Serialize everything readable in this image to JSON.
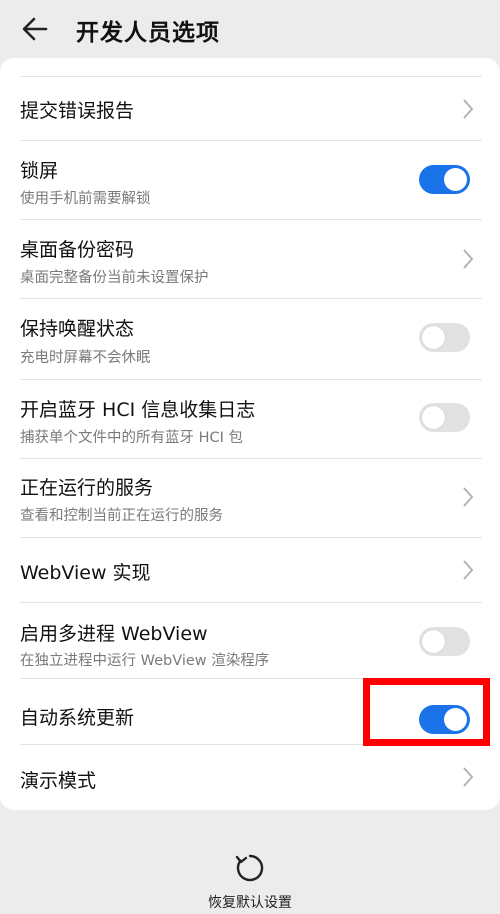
{
  "header": {
    "title": "开发人员选项",
    "back_icon": "arrow-left-icon"
  },
  "settings": [
    {
      "label": "提交错误报告",
      "sub": "",
      "control": "chevron"
    },
    {
      "label": "锁屏",
      "sub": "使用手机前需要解锁",
      "control": "toggle",
      "on": true
    },
    {
      "label": "桌面备份密码",
      "sub": "桌面完整备份当前未设置保护",
      "control": "chevron"
    },
    {
      "label": "保持唤醒状态",
      "sub": "充电时屏幕不会休眠",
      "control": "toggle",
      "on": false
    },
    {
      "label": "开启蓝牙 HCI 信息收集日志",
      "sub": "捕获单个文件中的所有蓝牙 HCI 包",
      "control": "toggle",
      "on": false
    },
    {
      "label": "正在运行的服务",
      "sub": "查看和控制当前正在运行的服务",
      "control": "chevron"
    },
    {
      "label": "WebView 实现",
      "sub": "",
      "control": "chevron"
    },
    {
      "label": "启用多进程 WebView",
      "sub": "在独立进程中运行 WebView 渲染程序",
      "control": "toggle",
      "on": false
    },
    {
      "label": "自动系统更新",
      "sub": "",
      "control": "toggle",
      "on": true
    },
    {
      "label": "演示模式",
      "sub": "",
      "control": "chevron"
    }
  ],
  "footer": {
    "reset_label": "恢复默认设置",
    "reset_icon": "refresh-icon"
  },
  "colors": {
    "accent": "#1a73e8",
    "highlight": "#ff0000",
    "toggle_off": "#e1e1e1"
  }
}
